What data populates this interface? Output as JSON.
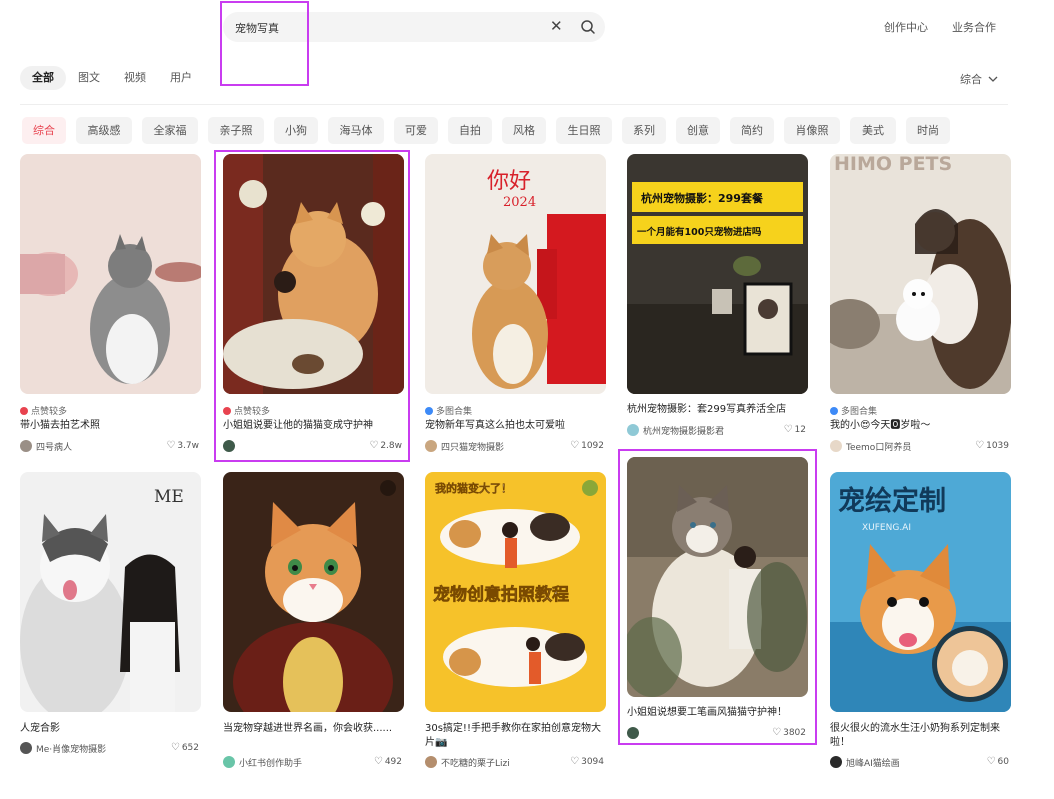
{
  "search": {
    "query": "宠物写真",
    "clear_icon": "close-icon",
    "search_icon": "search-icon"
  },
  "top_links": [
    "创作中心",
    "业务合作"
  ],
  "tabs": [
    {
      "label": "全部",
      "active": true
    },
    {
      "label": "图文"
    },
    {
      "label": "视频"
    },
    {
      "label": "用户"
    }
  ],
  "sort": {
    "label": "综合",
    "icon": "chevron-down-icon"
  },
  "chips": [
    {
      "label": "综合",
      "active": true
    },
    {
      "label": "高级感"
    },
    {
      "label": "全家福"
    },
    {
      "label": "亲子照"
    },
    {
      "label": "小狗"
    },
    {
      "label": "海马体"
    },
    {
      "label": "可爱"
    },
    {
      "label": "自拍"
    },
    {
      "label": "风格"
    },
    {
      "label": "生日照"
    },
    {
      "label": "系列"
    },
    {
      "label": "创意"
    },
    {
      "label": "简约"
    },
    {
      "label": "肖像照"
    },
    {
      "label": "美式"
    },
    {
      "label": "时尚"
    }
  ],
  "colors": {
    "accent": "#e8434f",
    "highlight": "#c93cf0",
    "tag_blue": "#3d8af7"
  },
  "cards": [
    {
      "meta": "点赞较多",
      "meta_color": "#e8434f",
      "title": "带小猫去拍艺术照",
      "author": "四号病人",
      "likes": "3.7w"
    },
    {
      "meta": "点赞较多",
      "meta_color": "#e8434f",
      "title": "小姐姐说要让他的猫猫变成守护神",
      "author": "",
      "likes": "2.8w"
    },
    {
      "meta": "多图合集",
      "meta_color": "#3d8af7",
      "title": "宠物新年写真这么拍也太可爱啦",
      "author": "四只猫宠物摄影",
      "likes": "1092",
      "img_text": [
        "你好",
        "2024"
      ]
    },
    {
      "meta": "",
      "title": "杭州宠物摄影：套299写真养活全店",
      "author": "杭州宠物摄影摄影君",
      "likes": "12",
      "img_text": [
        "杭州宠物摄影：299套餐",
        "一个月能有100只宠物进店吗"
      ]
    },
    {
      "meta": "多图合集",
      "meta_color": "#3d8af7",
      "title": "我的小😍今天🅾岁啦～",
      "author": "Teemo口阿养员",
      "likes": "1039",
      "img_text": [
        "HIMO PETS"
      ]
    },
    {
      "meta": "",
      "title": "人宠合影",
      "author": "Me·肖像宠物摄影",
      "likes": "652",
      "img_text": [
        "ME"
      ]
    },
    {
      "meta": "",
      "title": "当宠物穿越进世界名画，你会收获......",
      "author": "小红书创作助手",
      "likes": "492"
    },
    {
      "meta": "",
      "title": "30s搞定!!手把手教你在家拍创意宠物大片📷",
      "author": "不吃糖的栗子Lizi",
      "likes": "3094",
      "img_text": [
        "我的猫变大了！",
        "宠物创意拍照教程"
      ]
    },
    {
      "meta": "",
      "title": "小姐姐说想要工笔画风猫猫守护神！",
      "author": "",
      "likes": "3802"
    },
    {
      "meta": "",
      "title": "很火很火的流水生汪小奶狗系列定制来啦！",
      "author": "旭峰AI猫绘画",
      "likes": "60",
      "img_text": [
        "宠绘定制",
        "XUFENG.AI"
      ]
    }
  ]
}
